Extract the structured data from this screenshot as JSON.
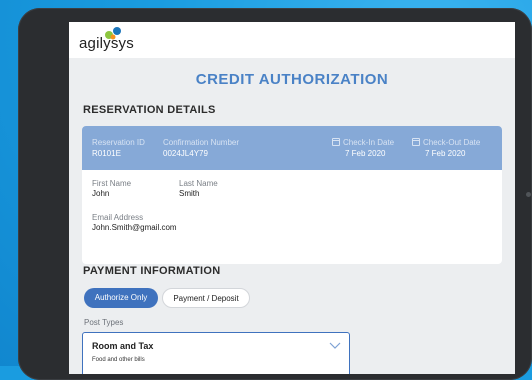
{
  "app": {
    "logo_text": "agilysys"
  },
  "page": {
    "title": "CREDIT AUTHORIZATION"
  },
  "reservation": {
    "section_title": "RESERVATION DETAILS",
    "reservation_id_label": "Reservation ID",
    "reservation_id": "R0101E",
    "confirmation_label": "Confirmation Number",
    "confirmation": "0024JL4Y79",
    "checkin_label": "Check-In Date",
    "checkin": "7 Feb 2020",
    "checkout_label": "Check-Out Date",
    "checkout": "7 Feb 2020",
    "first_name_label": "First Name",
    "first_name": "John",
    "last_name_label": "Last Name",
    "last_name": "Smith",
    "email_label": "Email Address",
    "email": "John.Smith@gmail.com"
  },
  "payment": {
    "section_title": "PAYMENT  INFORMATION",
    "authorize_label": "Authorize Only",
    "payment_label": "Payment / Deposit",
    "post_types_label": "Post Types",
    "post_type_selected": "Room and Tax",
    "post_type_sub": "Food and other bills"
  },
  "colors": {
    "accent": "#3f72be",
    "title": "#4a82c6",
    "card_header": "#86a9d7",
    "background": "#1a9ce0"
  },
  "icons": [
    "calendar-icon",
    "chevron-down-icon"
  ]
}
